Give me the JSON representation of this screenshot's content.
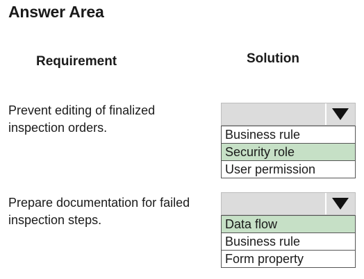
{
  "title": "Answer Area",
  "headers": {
    "requirement": "Requirement",
    "solution": "Solution"
  },
  "rows": [
    {
      "requirement": "Prevent editing of finalized inspection orders.",
      "requirement_line1": "Prevent editing of finalized",
      "requirement_line2": "inspection orders.",
      "options": [
        "Business rule",
        "Security role",
        "User permission"
      ],
      "selected_index": 1
    },
    {
      "requirement": "Prepare documentation for failed inspection steps.",
      "requirement_line1": "Prepare documentation for failed",
      "requirement_line2": "inspection steps.",
      "options": [
        "Data flow",
        "Business rule",
        "Form property"
      ],
      "selected_index": 0
    }
  ],
  "colors": {
    "selected_highlight": "#c6e0c6",
    "dropdown_background": "#dcdcdc"
  },
  "icons": {
    "dropdown_arrow": "triangle-down-icon"
  }
}
